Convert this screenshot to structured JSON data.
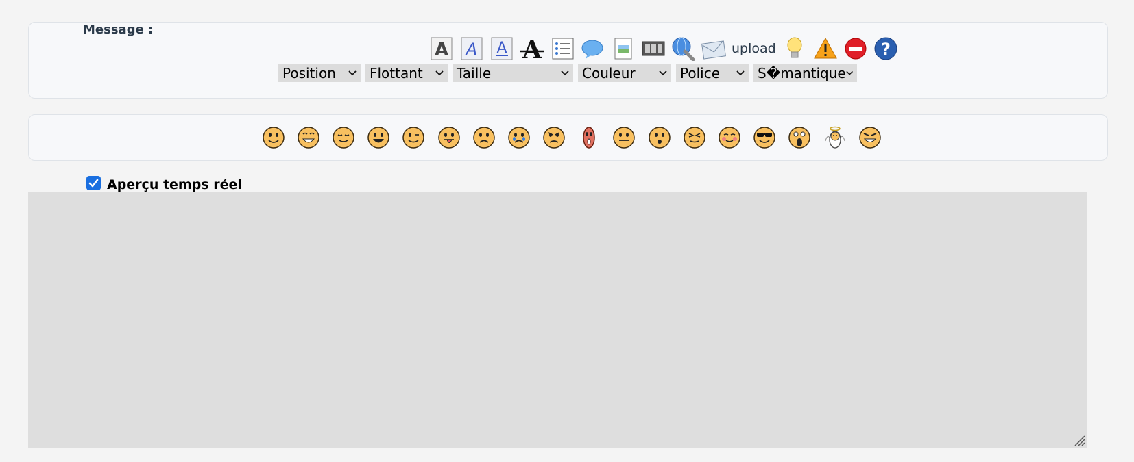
{
  "editor": {
    "message_label": "Message :",
    "toolbar": [
      {
        "name": "bold-icon",
        "glyph": "A"
      },
      {
        "name": "italic-icon",
        "glyph": "A"
      },
      {
        "name": "underline-icon",
        "glyph": "A"
      },
      {
        "name": "strikethrough-icon",
        "glyph": "A"
      },
      {
        "name": "list-icon"
      },
      {
        "name": "quote-bubble-icon"
      },
      {
        "name": "image-icon"
      },
      {
        "name": "video-icon"
      },
      {
        "name": "link-icon"
      },
      {
        "name": "email-icon"
      }
    ],
    "upload_label": "upload",
    "toolbar_tail": [
      "lightbulb-icon",
      "warning-icon",
      "stop-icon",
      "help-icon"
    ],
    "selects": [
      {
        "name": "position-select",
        "label": "Position"
      },
      {
        "name": "flottant-select",
        "label": "Flottant"
      },
      {
        "name": "taille-select",
        "label": "Taille"
      },
      {
        "name": "couleur-select",
        "label": "Couleur"
      },
      {
        "name": "police-select",
        "label": "Police"
      },
      {
        "name": "semantique-select",
        "label": "S�mantique"
      }
    ],
    "smileys": [
      "smile",
      "grin",
      "content",
      "laugh",
      "wink",
      "tongue",
      "sad",
      "cry",
      "angry",
      "red-alien",
      "neutral",
      "surprised",
      "squint",
      "blush",
      "cool",
      "shocked",
      "angel",
      "devil"
    ],
    "preview": {
      "label": "Aperçu temps réel",
      "checked": true
    },
    "colors": {
      "accent": "#1a6fe0",
      "textarea_bg": "#dedede",
      "panel_bg": "#f7f8fa"
    }
  }
}
